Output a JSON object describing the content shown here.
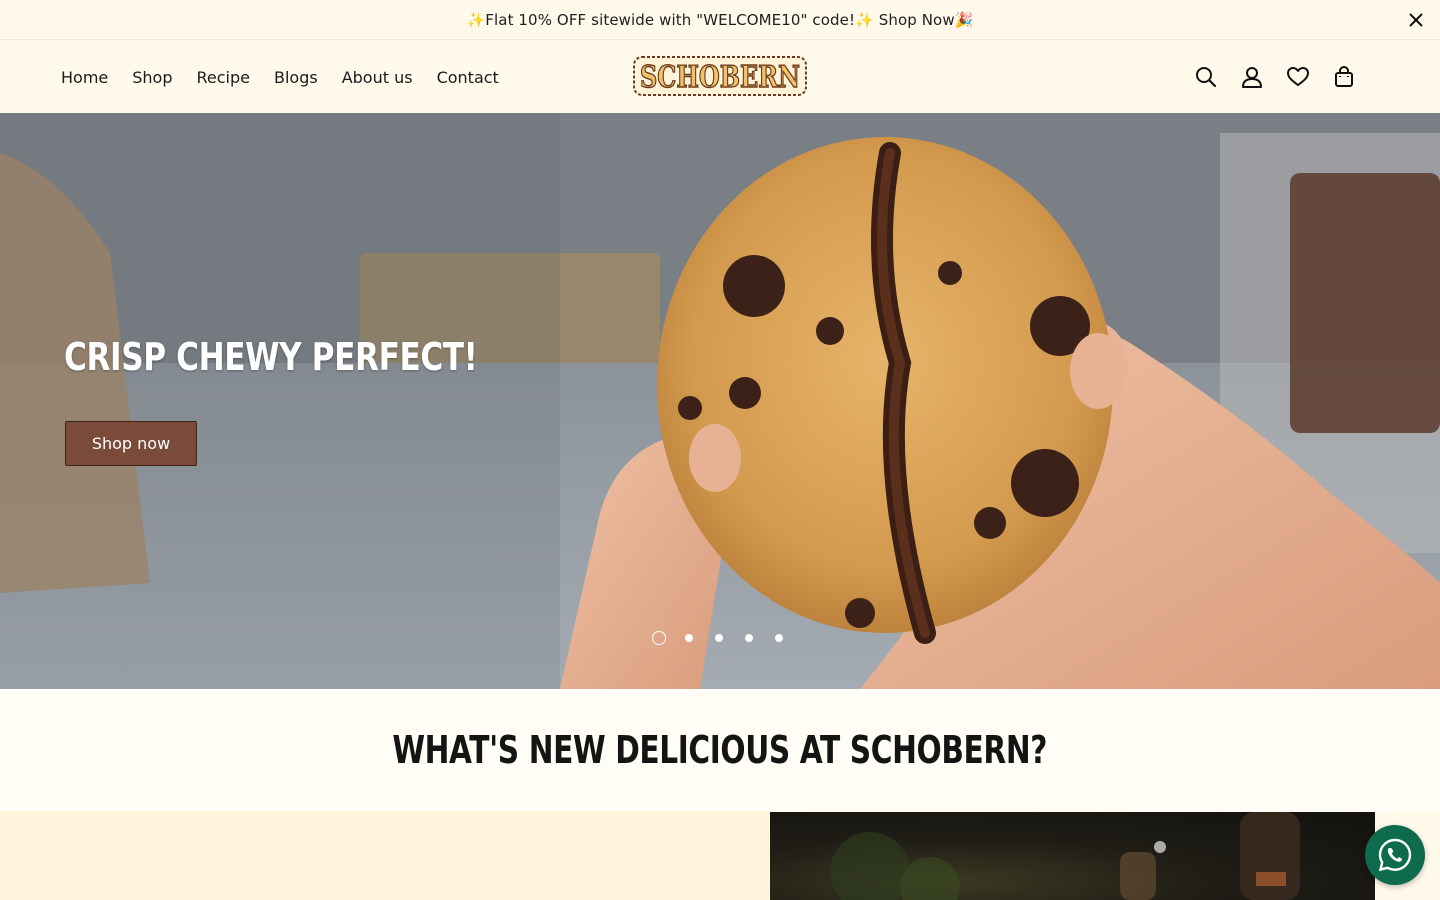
{
  "announcement": {
    "text": "✨Flat 10% OFF sitewide with \"WELCOME10\" code!✨ Shop Now🎉",
    "close_icon": "close-icon"
  },
  "nav": {
    "items": [
      {
        "label": "Home"
      },
      {
        "label": "Shop"
      },
      {
        "label": "Recipe"
      },
      {
        "label": "Blogs"
      },
      {
        "label": "About us"
      },
      {
        "label": "Contact"
      }
    ]
  },
  "logo": {
    "text": "SCHOBERN"
  },
  "header_icons": [
    "search-icon",
    "account-icon",
    "wishlist-heart-icon",
    "cart-bag-icon"
  ],
  "hero": {
    "title": "CRISP CHEWY PERFECT!",
    "button_label": "Shop now",
    "slide_count": 5,
    "active_slide": 1
  },
  "section": {
    "heading": "WHAT'S NEW DELICIOUS AT SCHOBERN?"
  },
  "colors": {
    "background": "#fff9ec",
    "button": "#7a4b39",
    "logo_brown": "#6b3b1e",
    "whatsapp": "#0f6b4e"
  }
}
